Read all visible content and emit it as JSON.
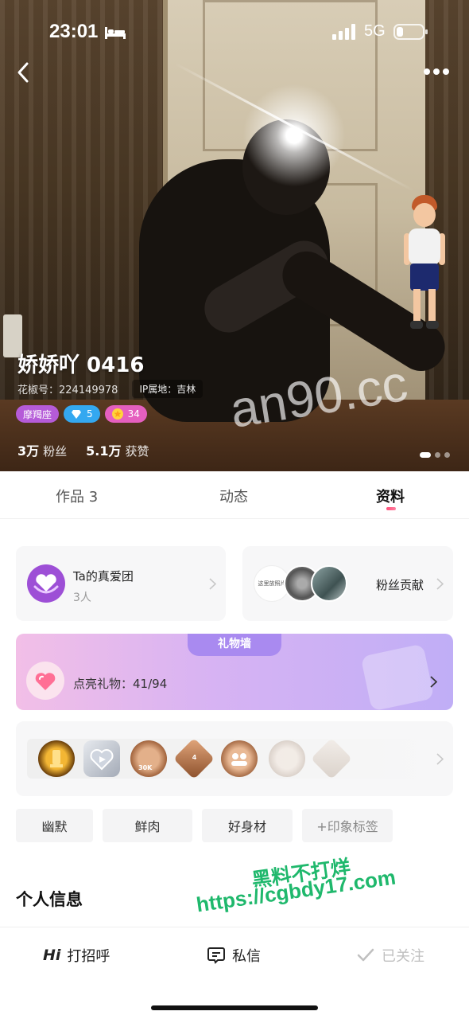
{
  "status_bar": {
    "time": "23:01",
    "network": "5G"
  },
  "profile": {
    "name": "娇娇吖 0416",
    "id_line": "花椒号：224149978",
    "ip_location": "IP属地：吉林",
    "badges": {
      "zodiac": "摩羯座",
      "diamond_level": "5",
      "star_level": "34"
    },
    "stats": [
      {
        "value": "3万",
        "label": "粉丝"
      },
      {
        "value": "5.1万",
        "label": "获赞"
      }
    ],
    "photo_pager": {
      "count": 3,
      "current": 1
    }
  },
  "tabs": [
    {
      "label": "作品 3",
      "active": false
    },
    {
      "label": "动态",
      "active": false
    },
    {
      "label": "资料",
      "active": true
    }
  ],
  "fan_club": {
    "title": "Ta的真爱团",
    "count": "3人"
  },
  "fan_contribution": {
    "title": "粉丝贡献",
    "avatar_caption": "这里放照片"
  },
  "gift_wall": {
    "header": "礼物墙",
    "lit_label": "点亮礼物：",
    "lit_value": "41/94"
  },
  "medals": {
    "items": [
      {
        "icon": "gold-trophy-medal-icon"
      },
      {
        "icon": "silver-heart-play-medal-icon"
      },
      {
        "icon": "bronze-30k-medal-icon",
        "text": "30K"
      },
      {
        "icon": "bronze-level-4-medal-icon",
        "text": "4"
      },
      {
        "icon": "bronze-group-medal-icon"
      },
      {
        "icon": "gray-locked-medal-icon"
      },
      {
        "icon": "gray-locked-medal-icon-2"
      }
    ]
  },
  "tags": [
    "幽默",
    "鲜肉",
    "好身材",
    "+印象标签"
  ],
  "section": {
    "personal_info": "个人信息"
  },
  "bottom_bar": {
    "greet_prefix": "Hi",
    "greet_label": "打招呼",
    "message_label": "私信",
    "follow_label": "已关注"
  },
  "watermarks": {
    "photo": "an90.cc",
    "overlay_line1": "黑料不打烊",
    "overlay_line2": "https://cgbdy17.com"
  },
  "colors": {
    "accent_pink": "#ff4f7a",
    "zodiac_badge": "#b55bd8",
    "diamond_badge": "#34a8f0",
    "star_badge": "#e55fbf",
    "fan_club_purple": "#9d4fd6",
    "watermark_green": "#1fb86c"
  }
}
